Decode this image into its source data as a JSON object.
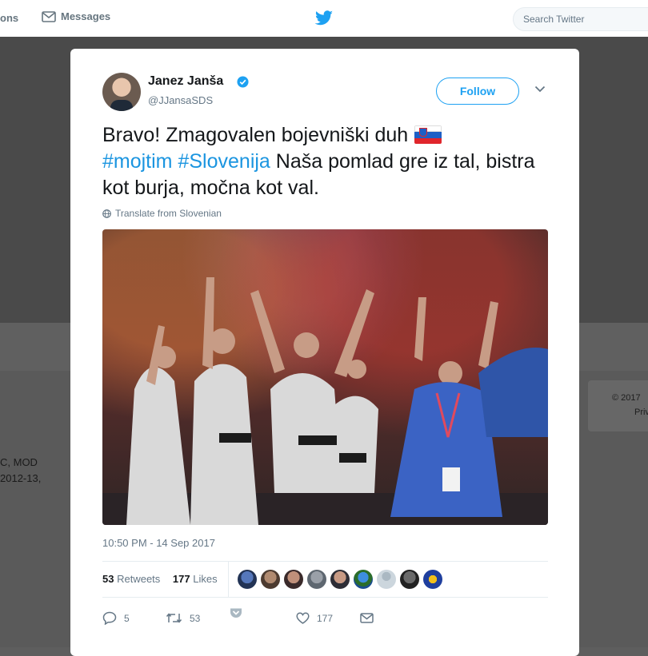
{
  "nav": {
    "notifications_label": "ons",
    "messages_label": "Messages",
    "search_placeholder": "Search Twitter"
  },
  "background": {
    "bio_line1": "C, MOD",
    "bio_line2": "2012-13,",
    "footer_line1": "© 2017",
    "footer_line2": "Priv"
  },
  "tweet": {
    "author_name": "Janez Janša",
    "author_handle": "@JJansaSDS",
    "follow_label": "Follow",
    "text_part1": "Bravo! Zmagovalen bojevniški duh",
    "hashtag1": "#mojtim",
    "hashtag2": "#Slovenija",
    "text_part2": "Naša pomlad gre iz tal, bistra kot burja, močna kot val.",
    "translate_label": "Translate from Slovenian",
    "timestamp": "10:50 PM - 14 Sep 2017",
    "retweets_count": "53",
    "retweets_label": "Retweets",
    "likes_count": "177",
    "likes_label": "Likes",
    "reply_count": "5",
    "retweet_action_count": "53",
    "like_action_count": "177"
  },
  "colors": {
    "accent": "#1da1f2",
    "hashtag": "#1b95e0",
    "text": "#14171a",
    "muted": "#657786"
  },
  "icons": {
    "verified": "verified-badge-icon",
    "reply": "reply-icon",
    "retweet": "retweet-icon",
    "like": "heart-icon",
    "dm": "envelope-icon",
    "globe": "globe-icon"
  }
}
